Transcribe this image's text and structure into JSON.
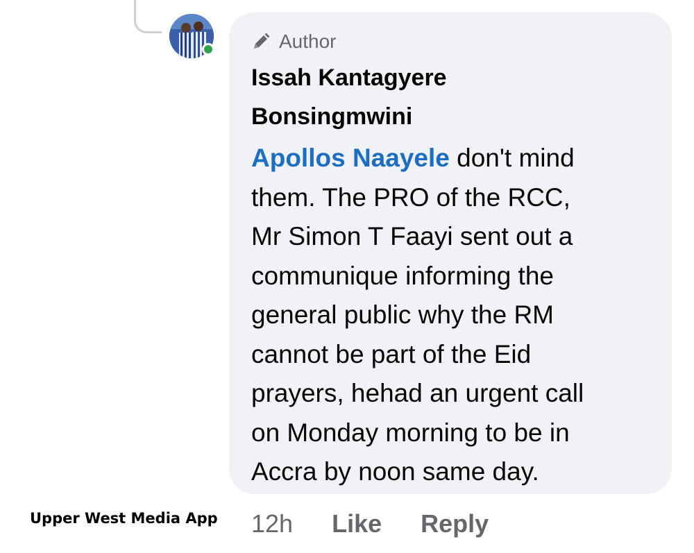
{
  "comment": {
    "badge": {
      "icon": "pencil-icon",
      "label": "Author"
    },
    "author": {
      "name_line1": "Issah Kantagyere",
      "name_line2": "Bonsingmwini",
      "online": true
    },
    "mention": "Apollos Naayele",
    "text_lines": [
      " don't mind",
      "them. The PRO of the RCC,",
      "Mr Simon T Faayi sent out a",
      "communique informing the",
      "general public why the RM",
      "cannot be part of the Eid",
      "prayers, hehad an urgent call",
      "on Monday morning to be in",
      "Accra by noon same day."
    ],
    "timestamp": "12h",
    "like_label": "Like",
    "reply_label": "Reply"
  },
  "watermark": "Upper West Media App",
  "colors": {
    "bubble_bg": "#f0f2f5",
    "mention": "#1b6ec2",
    "muted": "#65676b",
    "online": "#31a24c"
  }
}
